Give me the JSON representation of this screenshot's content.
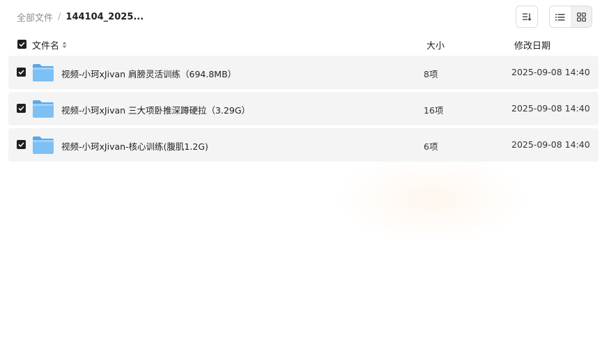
{
  "breadcrumb": {
    "root": "全部文件",
    "separator": "/",
    "current": "144104_2025..."
  },
  "toolbar": {
    "sort_icon": "sort-icon",
    "list_view_icon": "list-view-icon",
    "grid_view_icon": "grid-view-icon"
  },
  "table": {
    "headers": {
      "name": "文件名",
      "size": "大小",
      "date": "修改日期"
    },
    "rows": [
      {
        "name": "视频-小珂xJivan 肩膀灵活训练（694.8MB）",
        "size": "8项",
        "date": "2025-09-08 14:40",
        "checked": true,
        "icon": "folder-icon"
      },
      {
        "name": "视频-小珂xJivan 三大项卧推深蹲硬拉（3.29G）",
        "size": "16项",
        "date": "2025-09-08 14:40",
        "checked": true,
        "icon": "folder-icon"
      },
      {
        "name": "视频-小珂xJivan-核心训练(腹肌1.2G)",
        "size": "6项",
        "date": "2025-09-08 14:40",
        "checked": true,
        "icon": "folder-icon"
      }
    ]
  },
  "colors": {
    "row_bg": "#f4f4f5",
    "checkbox": "#1f1f1f",
    "folder": "#6fb5f2"
  }
}
